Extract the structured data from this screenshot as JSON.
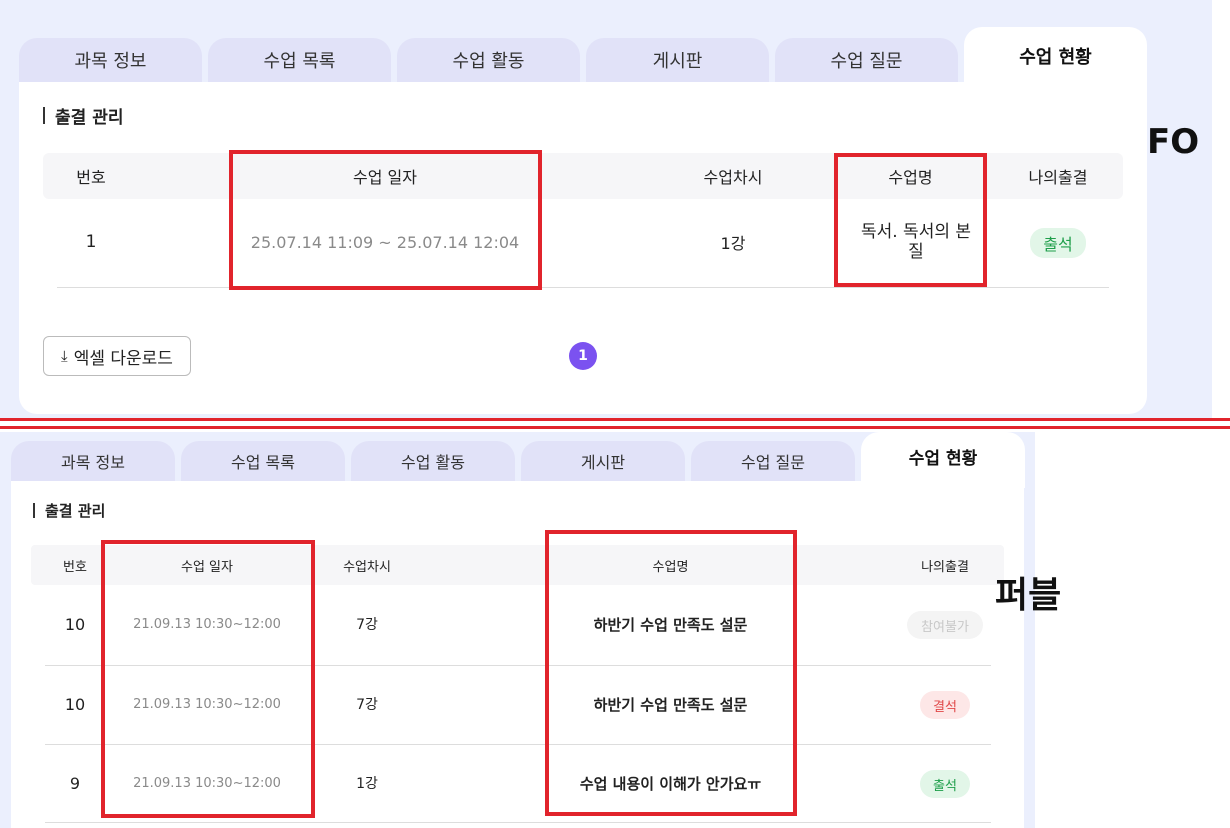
{
  "tabs": [
    "과목 정보",
    "수업 목록",
    "수업 활동",
    "게시판",
    "수업 질문",
    "수업 현황"
  ],
  "top": {
    "section_title": "출결 관리",
    "side_label": "FO",
    "headers": [
      "번호",
      "수업 일자",
      "수업차시",
      "수업명",
      "나의출결"
    ],
    "rows": [
      {
        "no": "1",
        "date": "25.07.14 11:09 ~ 25.07.14 12:04",
        "session": "1강",
        "name": "독서. 독서의 본질",
        "status": "출석"
      }
    ],
    "excel_button": "엑셀 다운로드",
    "excel_icon": "download-icon",
    "page": "1"
  },
  "bottom": {
    "section_title": "출결 관리",
    "side_label": "퍼블",
    "headers": [
      "번호",
      "수업 일자",
      "수업차시",
      "수업명",
      "나의출결"
    ],
    "rows": [
      {
        "no": "10",
        "date": "21.09.13 10:30~12:00",
        "session": "7강",
        "name": "하반기 수업 만족도 설문",
        "status": "참여불가"
      },
      {
        "no": "10",
        "date": "21.09.13 10:30~12:00",
        "session": "7강",
        "name": "하반기 수업 만족도 설문",
        "status": "결석"
      },
      {
        "no": "9",
        "date": "21.09.13 10:30~12:00",
        "session": "1강",
        "name": "수업 내용이 이해가 안가요ㅠ",
        "status": "출석"
      }
    ]
  },
  "colors": {
    "accent": "#7b52f0",
    "annotation_red": "#e1242c",
    "background": "#ebeffd",
    "attend": "#1e9e4a",
    "absent": "#e04848"
  }
}
